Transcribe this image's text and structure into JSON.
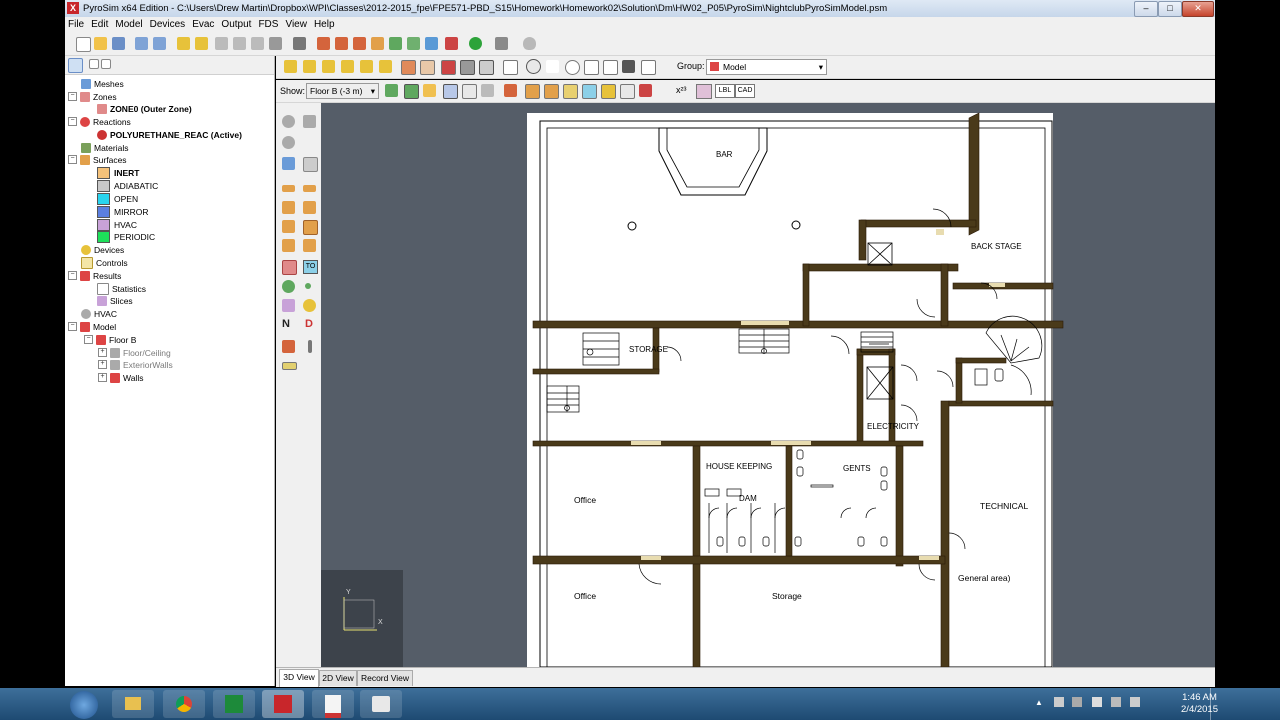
{
  "window": {
    "title": "PyroSim x64 Edition - C:\\Users\\Drew Martin\\Dropbox\\WPI\\Classes\\2012-2015_fpe\\FPE571-PBD_S15\\Homework\\Homework02\\Solution\\Dm\\HW02_P05\\PyroSim\\NightclubPyroSimModel.psm",
    "logo": "X",
    "minimize": "–",
    "maximize": "□",
    "close": "✕"
  },
  "menu": [
    "File",
    "Edit",
    "Model",
    "Devices",
    "Evac",
    "Output",
    "FDS",
    "View",
    "Help"
  ],
  "tree": {
    "items": [
      {
        "label": "Meshes",
        "level": 1,
        "icon": "mesh-icon"
      },
      {
        "label": "Zones",
        "level": 1,
        "icon": "zones-icon"
      },
      {
        "label": "ZONE0 (Outer Zone)",
        "level": 2,
        "bold": true,
        "icon": "zone-icon"
      },
      {
        "label": "Reactions",
        "level": 1,
        "icon": "reactions-icon"
      },
      {
        "label": "POLYURETHANE_REAC (Active)",
        "level": 2,
        "bold": true,
        "icon": "reaction-icon"
      },
      {
        "label": "Materials",
        "level": 1,
        "icon": "materials-icon"
      },
      {
        "label": "Surfaces",
        "level": 1,
        "icon": "surfaces-icon"
      },
      {
        "label": "INERT",
        "level": 2,
        "bold": true,
        "swatch": "#f5c27a"
      },
      {
        "label": "ADIABATIC",
        "level": 2,
        "swatch": "#c8c8c8"
      },
      {
        "label": "OPEN",
        "level": 2,
        "swatch": "#29d4ee"
      },
      {
        "label": "MIRROR",
        "level": 2,
        "swatch": "#5b7fe0"
      },
      {
        "label": "HVAC",
        "level": 2,
        "swatch": "#c8a2d8"
      },
      {
        "label": "PERIODIC",
        "level": 2,
        "swatch": "#1ee05a"
      },
      {
        "label": "Devices",
        "level": 1,
        "icon": "devices-icon"
      },
      {
        "label": "Controls",
        "level": 1,
        "icon": "controls-icon"
      },
      {
        "label": "Results",
        "level": 1,
        "icon": "results-icon"
      },
      {
        "label": "Statistics",
        "level": 2,
        "icon": "statistics-icon"
      },
      {
        "label": "Slices",
        "level": 2,
        "icon": "slices-icon"
      },
      {
        "label": "HVAC",
        "level": 1,
        "icon": "hvac-icon"
      },
      {
        "label": "Model",
        "level": 1,
        "icon": "model-icon"
      },
      {
        "label": "Floor B",
        "level": 2,
        "icon": "floor-icon"
      },
      {
        "label": "Floor/Ceiling",
        "level": 3,
        "grey": true,
        "icon": "group-icon"
      },
      {
        "label": "ExteriorWalls",
        "level": 3,
        "grey": true,
        "icon": "group-icon"
      },
      {
        "label": "Walls",
        "level": 3,
        "icon": "walls-icon"
      }
    ]
  },
  "view_toolbar": {
    "group_label": "Group:",
    "group_value": "Model",
    "show_label": "Show:",
    "show_value": "Floor B (-3 m)",
    "lbl_button": "LBL",
    "cad_button": "CAD",
    "stats_label": "x²³"
  },
  "left_tools": {
    "n_label": "N",
    "d_label": "D",
    "to_label": "TO"
  },
  "floorplan": {
    "labels": {
      "bar": "BAR",
      "back_stage": "BACK STAGE",
      "storage_top": "STORAGE",
      "electricity": "ELECTRICITY",
      "house_keeping": "HOUSE KEEPING",
      "dam": "DAM",
      "gents": "GENTS",
      "office_1": "Office",
      "office_2": "Office",
      "storage_bottom": "Storage",
      "technical": "TECHNICAL",
      "general_area": "General area)"
    },
    "axes": {
      "x": "X",
      "y": "Y"
    }
  },
  "tabs": [
    "3D View",
    "2D View",
    "Record View"
  ],
  "taskbar": {
    "time": "1:46 AM",
    "date": "2/4/2015"
  }
}
